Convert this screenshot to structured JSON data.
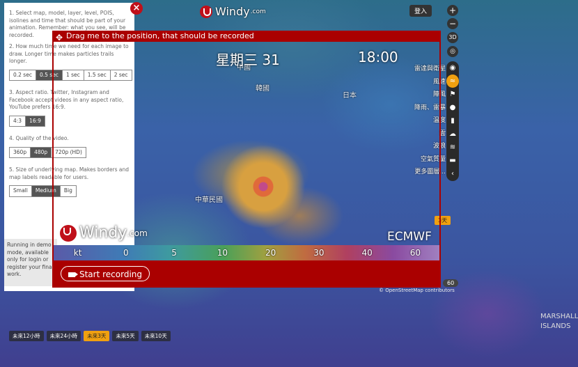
{
  "brand": {
    "name": "Windy",
    "suffix": ".com"
  },
  "header": {
    "login_label": "登入"
  },
  "recorder": {
    "drag_hint": "Drag me to the position, that should be recorded",
    "day_label": "星期三 31",
    "time_label": "18:00",
    "model_label": "ECMWF",
    "start_label": "Start recording",
    "scale_unit": "kt",
    "scale_values": [
      "0",
      "5",
      "10",
      "20",
      "30",
      "40",
      "60"
    ]
  },
  "panel": {
    "step1": "1. Select map, model, layer, level, POIS, isolines and time that should be part of your animation. Remember: what you see, will be recorded.",
    "step2": "2. How much time we need for each image to draw. Longer time makes particles trails longer.",
    "durations": [
      "0.2 sec",
      "0.5 sec",
      "1 sec",
      "1.5 sec",
      "2 sec"
    ],
    "step3": "3. Aspect ratio. Twitter, Instagram and Facebook accept videos in any aspect ratio, YouTube prefers 16:9.",
    "ratios": [
      "4:3",
      "16:9"
    ],
    "step4": "4. Quality of the video.",
    "qualities": [
      "360p",
      "480p",
      "720p (HD)"
    ],
    "step5": "5. Size of underlying map. Makes borders and map labels readable for users.",
    "sizes": [
      "Small",
      "Medium",
      "Big"
    ],
    "notice": "Running in demo mode, available only for login or register your final work."
  },
  "layers": [
    "雷達與衛星",
    "風速",
    "陣風",
    "降雨、雷暴",
    "溫度",
    "雲",
    "波浪",
    "空氣質量",
    "更多圖層..."
  ],
  "map_labels": {
    "korea": "韓國",
    "japan": "日本",
    "taiwan": "中華民國",
    "north": "中國",
    "marshall": "MARSHALL ISLANDS",
    "osm": "© OpenStreetMap contributors"
  },
  "timeline": [
    "未來12小時",
    "未來24小時",
    "未來3天",
    "未來5天",
    "未來10天"
  ],
  "misc": {
    "badge": "3天",
    "pill": "60"
  },
  "colors": {
    "accent": "#aa0000",
    "active": "#f0a010"
  }
}
